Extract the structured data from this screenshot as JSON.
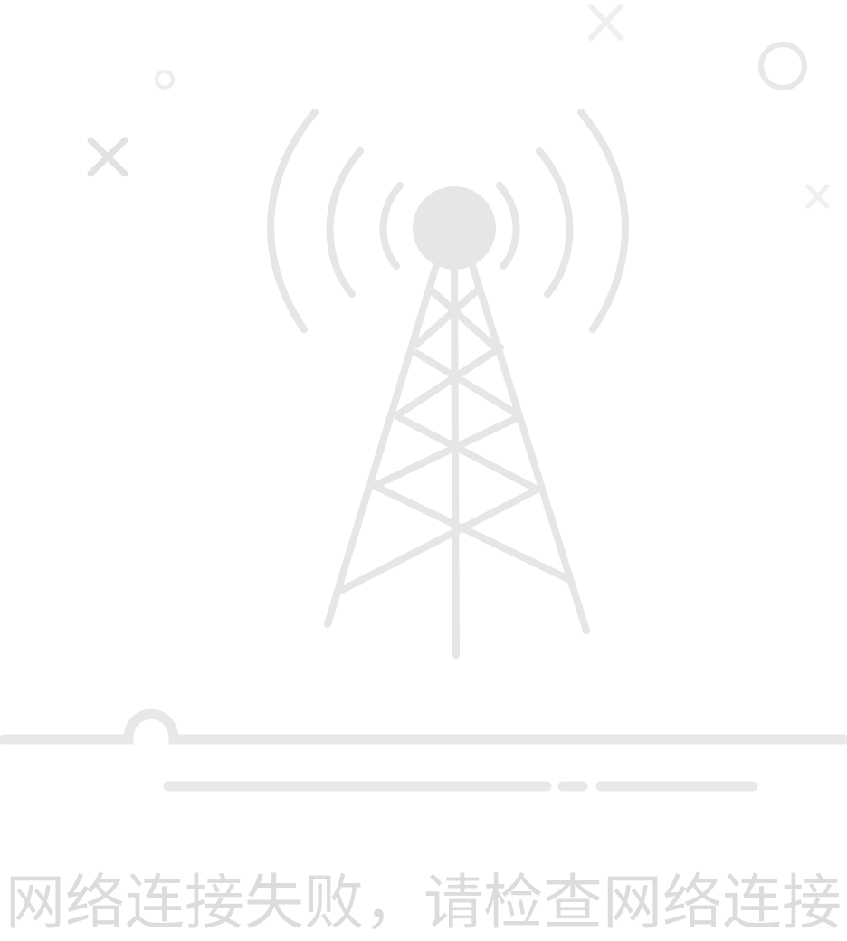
{
  "message": "网络连接失败，请检查网络连接",
  "colors": {
    "background": "#ffffff",
    "illustration": "#e6e6e6",
    "decor": "#ebebeb",
    "text": "#dcdcdc"
  },
  "icons": {
    "illustration": "signal-tower-icon"
  }
}
